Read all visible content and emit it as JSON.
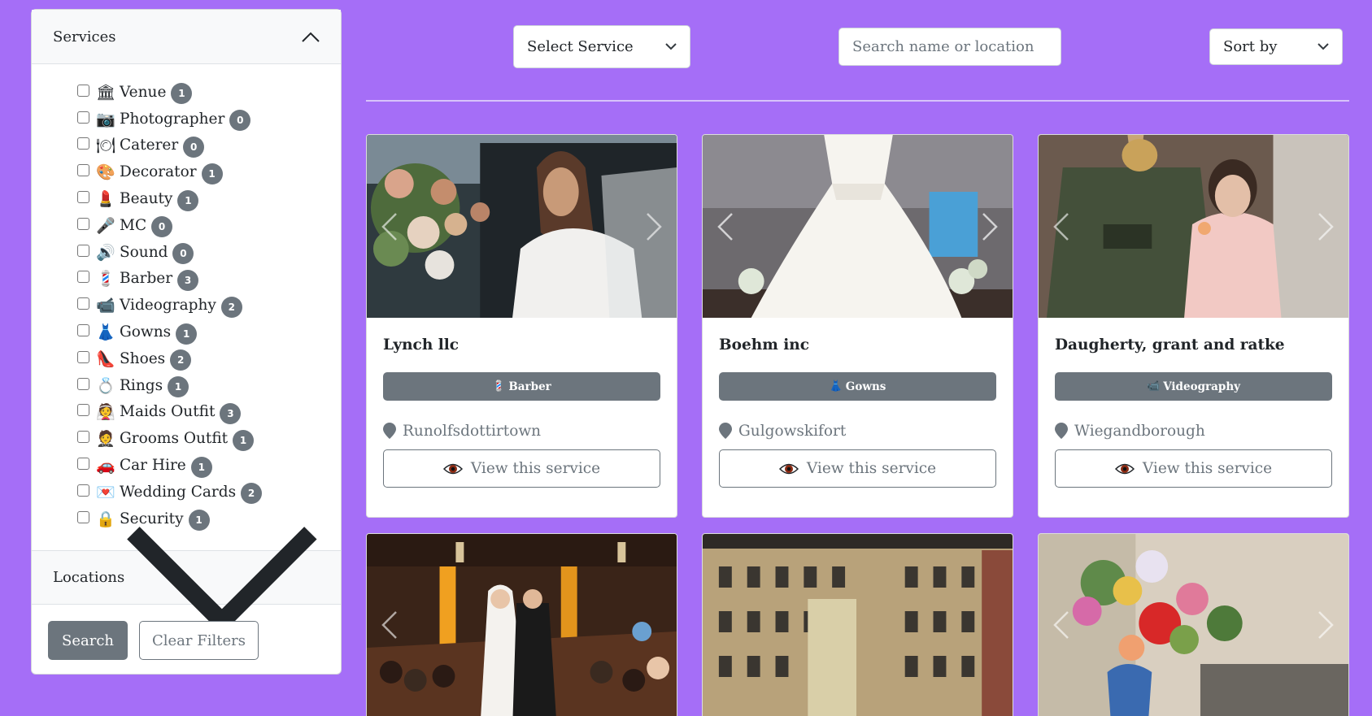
{
  "sidebar": {
    "services_header": "Services",
    "services": [
      {
        "emoji": "🏛",
        "label": "Venue",
        "count": "1"
      },
      {
        "emoji": "📷",
        "label": "Photographer",
        "count": "0"
      },
      {
        "emoji": "🍽",
        "label": "Caterer",
        "count": "0"
      },
      {
        "emoji": "🎨",
        "label": "Decorator",
        "count": "1"
      },
      {
        "emoji": "💄",
        "label": "Beauty",
        "count": "1"
      },
      {
        "emoji": "🎤",
        "label": "MC",
        "count": "0"
      },
      {
        "emoji": "🔊",
        "label": "Sound",
        "count": "0"
      },
      {
        "emoji": "💈",
        "label": "Barber",
        "count": "3"
      },
      {
        "emoji": "📹",
        "label": "Videography",
        "count": "2"
      },
      {
        "emoji": "👗",
        "label": "Gowns",
        "count": "1"
      },
      {
        "emoji": "👠",
        "label": "Shoes",
        "count": "2"
      },
      {
        "emoji": "💍",
        "label": "Rings",
        "count": "1"
      },
      {
        "emoji": "👰",
        "label": "Maids Outfit",
        "count": "3"
      },
      {
        "emoji": "🤵",
        "label": "Grooms Outfit",
        "count": "1"
      },
      {
        "emoji": "🚗",
        "label": "Car Hire",
        "count": "1"
      },
      {
        "emoji": "💌",
        "label": "Wedding Cards",
        "count": "2"
      },
      {
        "emoji": "🔒",
        "label": "Security",
        "count": "1"
      }
    ],
    "locations_header": "Locations",
    "search_button": "Search",
    "clear_button": "Clear Filters"
  },
  "toolbar": {
    "select_service": "Select Service",
    "search_placeholder": "Search name or location",
    "sort_by": "Sort by"
  },
  "cards": [
    {
      "title": "Lynch llc",
      "tag_emoji": "💈",
      "tag": "Barber",
      "location": "Runolfsdottirtown",
      "view": "View this service"
    },
    {
      "title": "Boehm inc",
      "tag_emoji": "👗",
      "tag": "Gowns",
      "location": "Gulgowskifort",
      "view": "View this service"
    },
    {
      "title": "Daugherty, grant and ratke",
      "tag_emoji": "📹",
      "tag": "Videography",
      "location": "Wiegandborough",
      "view": "View this service"
    }
  ],
  "colors": {
    "background": "#a56ef7",
    "badge": "#6c757d"
  },
  "icons": [
    "chevron-up-icon",
    "chevron-down-icon",
    "map-pin-icon",
    "eye-icon",
    "carousel-prev-icon",
    "carousel-next-icon"
  ]
}
